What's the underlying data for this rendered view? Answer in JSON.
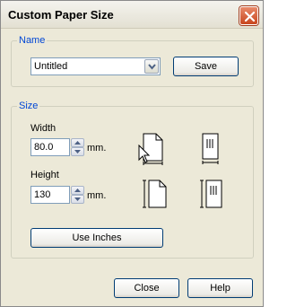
{
  "window": {
    "title": "Custom Paper Size"
  },
  "name_group": {
    "legend": "Name",
    "selected_value": "Untitled",
    "save_label": "Save"
  },
  "size_group": {
    "legend": "Size",
    "width_label": "Width",
    "width_value": "80.0",
    "width_unit": "mm.",
    "height_label": "Height",
    "height_value": "130",
    "height_unit": "mm.",
    "use_inches_label": "Use Inches"
  },
  "footer": {
    "close_label": "Close",
    "help_label": "Help"
  },
  "icons": [
    "close-icon",
    "dropdown-arrow-icon",
    "spin-up-icon",
    "spin-down-icon",
    "page-portrait-icon",
    "envelope-width-icon",
    "page-height-icon",
    "envelope-height-icon",
    "mouse-pointer-icon"
  ],
  "colors": {
    "accent": "#0046d5",
    "window_bg": "#ece9d8",
    "close_button": "#c8461e"
  }
}
